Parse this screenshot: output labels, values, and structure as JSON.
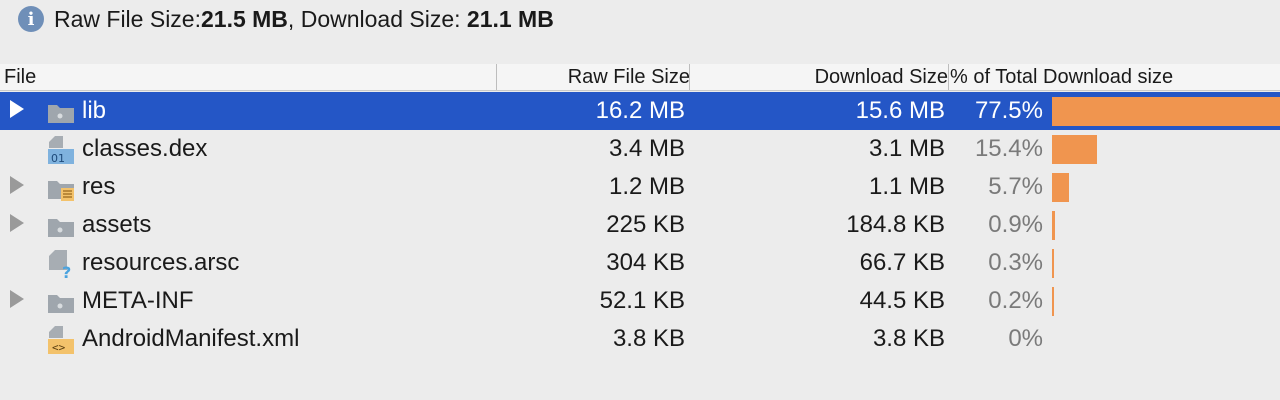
{
  "summary": {
    "raw_label": "Raw File Size: ",
    "raw_value": "21.5 MB",
    "sep": ", ",
    "download_label": "Download Size: ",
    "download_value": "21.1 MB"
  },
  "columns": {
    "file": "File",
    "raw": "Raw File Size",
    "download": "Download Size",
    "percent": "% of Total Download size"
  },
  "rows": [
    {
      "name": "lib",
      "raw": "16.2 MB",
      "download": "15.6 MB",
      "percent": "77.5%",
      "fraction": 0.775,
      "expandable": true,
      "selected": true,
      "icon": "folder-icon"
    },
    {
      "name": "classes.dex",
      "raw": "3.4 MB",
      "download": "3.1 MB",
      "percent": "15.4%",
      "fraction": 0.154,
      "expandable": false,
      "selected": false,
      "icon": "dex-file-icon"
    },
    {
      "name": "res",
      "raw": "1.2 MB",
      "download": "1.1 MB",
      "percent": "5.7%",
      "fraction": 0.057,
      "expandable": true,
      "selected": false,
      "icon": "resources-folder-icon"
    },
    {
      "name": "assets",
      "raw": "225 KB",
      "download": "184.8 KB",
      "percent": "0.9%",
      "fraction": 0.009,
      "expandable": true,
      "selected": false,
      "icon": "folder-icon"
    },
    {
      "name": "resources.arsc",
      "raw": "304 KB",
      "download": "66.7 KB",
      "percent": "0.3%",
      "fraction": 0.003,
      "expandable": false,
      "selected": false,
      "icon": "unknown-file-icon"
    },
    {
      "name": "META-INF",
      "raw": "52.1 KB",
      "download": "44.5 KB",
      "percent": "0.2%",
      "fraction": 0.002,
      "expandable": true,
      "selected": false,
      "icon": "folder-icon"
    },
    {
      "name": "AndroidManifest.xml",
      "raw": "3.8 KB",
      "download": "3.8 KB",
      "percent": "0%",
      "fraction": 0.0,
      "expandable": false,
      "selected": false,
      "icon": "xml-file-icon"
    }
  ],
  "colors": {
    "selection": "#2456c6",
    "bar": "#f0954f",
    "folder": "#9fa6ad"
  }
}
